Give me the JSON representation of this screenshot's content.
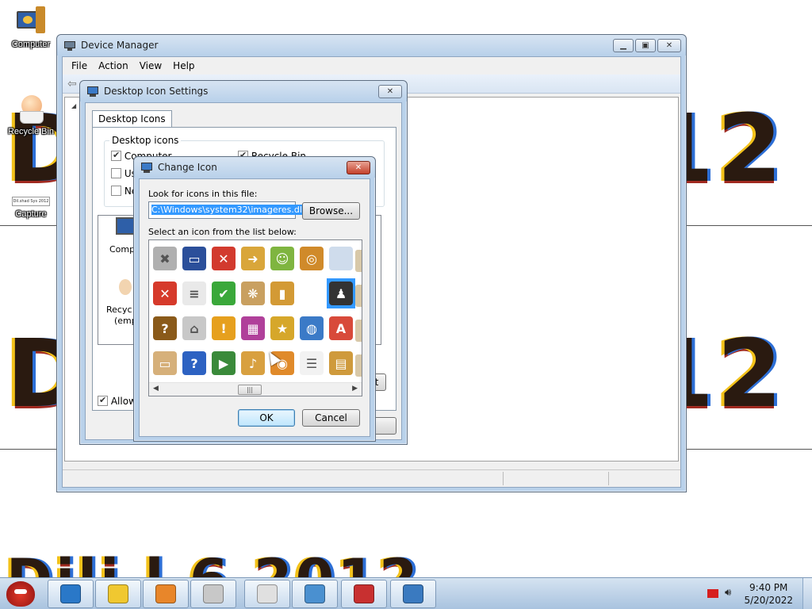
{
  "wallpaper": {
    "line1": "D",
    "line1_right": "12",
    "line2": "D",
    "line2_right": "12",
    "line3": "Dili  l  6  2012",
    "watermark_label": "Dil.shad Sys 2012"
  },
  "desktop": {
    "icons": [
      {
        "label": "Computer"
      },
      {
        "label": "Recycle Bin"
      },
      {
        "label": "Capture"
      }
    ]
  },
  "device_manager": {
    "title": "Device Manager",
    "menu": [
      "File",
      "Action",
      "View",
      "Help"
    ]
  },
  "desktop_icon_settings": {
    "title": "Desktop Icon Settings",
    "tab": "Desktop Icons",
    "group_label": "Desktop icons",
    "checkboxes": [
      {
        "label": "Computer",
        "checked": true
      },
      {
        "label": "Recycle Bin",
        "checked": true
      },
      {
        "label": "Use",
        "checked": false
      },
      {
        "label": "Ne",
        "checked": false
      }
    ],
    "preview_labels": [
      "Comp",
      "Recyc",
      "(emp"
    ],
    "allow_label": "Allow",
    "allow_checked": true,
    "partial_button": "t"
  },
  "change_icon": {
    "title": "Change Icon",
    "look_label": "Look for icons in this file:",
    "file_path": "C:\\Windows\\system32\\imageres.dll",
    "browse_label": "Browse...",
    "select_label": "Select an icon from the list below:",
    "ok_label": "OK",
    "cancel_label": "Cancel",
    "icons": [
      {
        "name": "gray-x-icon",
        "color": "#b0b0b0",
        "glyph": "✖"
      },
      {
        "name": "monitor-icon",
        "color": "#2b4f9a",
        "glyph": "▭"
      },
      {
        "name": "red-shield-x-icon",
        "color": "#d23a2e",
        "glyph": "✕"
      },
      {
        "name": "folder-arrow-icon",
        "color": "#d9a63a",
        "glyph": "➜"
      },
      {
        "name": "shield-person-icon",
        "color": "#7fb540",
        "glyph": "☺"
      },
      {
        "name": "folder-disc-icon",
        "color": "#d08a2a",
        "glyph": "◎"
      },
      {
        "name": "blank-page-icon",
        "color": "#cfdcec",
        "glyph": ""
      },
      {
        "name": "red-x-circle-icon",
        "color": "#d63a2b",
        "glyph": "✕"
      },
      {
        "name": "document-icon",
        "color": "#e9e9e9",
        "glyph": "≡"
      },
      {
        "name": "green-shield-check-icon",
        "color": "#3aa83a",
        "glyph": "✔"
      },
      {
        "name": "certificate-icon",
        "color": "#c9a060",
        "glyph": "❋"
      },
      {
        "name": "folder-books-icon",
        "color": "#d39a35",
        "glyph": "▮"
      },
      {
        "name": "empty-slot-icon",
        "color": "#ffffff",
        "glyph": ""
      },
      {
        "name": "user-folder-icon",
        "color": "#333333",
        "glyph": "♟"
      },
      {
        "name": "help-book-icon",
        "color": "#8a5a1a",
        "glyph": "?"
      },
      {
        "name": "projector-icon",
        "color": "#c8c8c8",
        "glyph": "⌂"
      },
      {
        "name": "warning-shield-icon",
        "color": "#e6a01e",
        "glyph": "!"
      },
      {
        "name": "installer-icon",
        "color": "#b0409a",
        "glyph": "▦"
      },
      {
        "name": "star-icon",
        "color": "#d6a72a",
        "glyph": "★"
      },
      {
        "name": "network-globe-icon",
        "color": "#3b7ac7",
        "glyph": "◍"
      },
      {
        "name": "font-icon",
        "color": "#d84a3a",
        "glyph": "A"
      },
      {
        "name": "tablet-icon",
        "color": "#d6b07a",
        "glyph": "▭"
      },
      {
        "name": "help-shield-icon",
        "color": "#2d62c2",
        "glyph": "?"
      },
      {
        "name": "media-play-icon",
        "color": "#3a8a3a",
        "glyph": "▶"
      },
      {
        "name": "folder-music-icon",
        "color": "#d8a040",
        "glyph": "♪"
      },
      {
        "name": "bag-icon",
        "color": "#e08a2a",
        "glyph": "◉"
      },
      {
        "name": "list-doc-icon",
        "color": "#f2f2f2",
        "glyph": "☰"
      },
      {
        "name": "folder-video-icon",
        "color": "#cf9a3c",
        "glyph": "▤"
      },
      {
        "name": "font-outline-icon",
        "color": "#5aa0d8",
        "glyph": "A"
      }
    ]
  },
  "taskbar": {
    "time": "9:40 PM",
    "date": "5/20/2022",
    "buttons": [
      {
        "name": "ie-button"
      },
      {
        "name": "contacts-button"
      },
      {
        "name": "media-button"
      },
      {
        "name": "paint-button"
      },
      {
        "name": "snipping-button"
      },
      {
        "name": "screenshot-button"
      },
      {
        "name": "toolbox-button"
      },
      {
        "name": "display-button"
      }
    ]
  }
}
